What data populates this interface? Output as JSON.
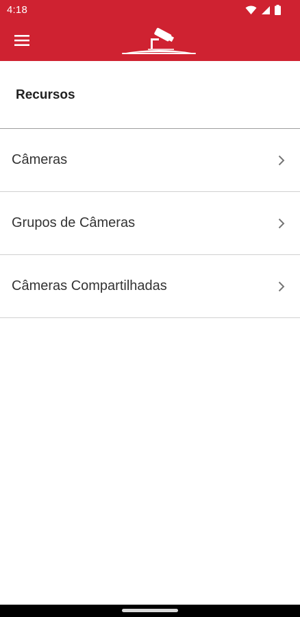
{
  "status_bar": {
    "time": "4:18",
    "icons": [
      "wifi-icon",
      "signal-icon",
      "battery-icon"
    ]
  },
  "app_bar": {
    "menu_icon": "hamburger-menu-icon",
    "logo": "security-camera-logo",
    "background": "#cf2231"
  },
  "section": {
    "title": "Recursos"
  },
  "items": [
    {
      "label": "Câmeras"
    },
    {
      "label": "Grupos de Câmeras"
    },
    {
      "label": "Câmeras Compartilhadas"
    }
  ]
}
